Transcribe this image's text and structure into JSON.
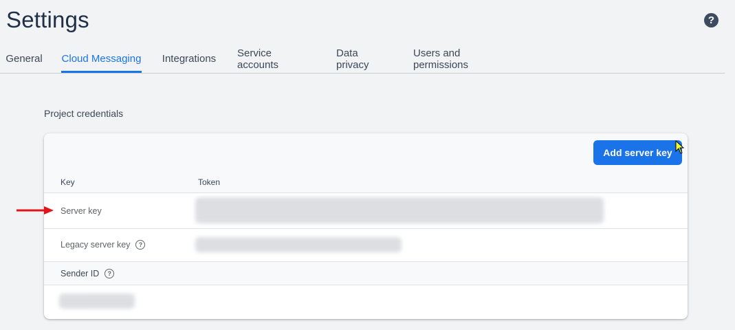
{
  "header": {
    "title": "Settings",
    "help_icon": "help-icon"
  },
  "tabs": [
    {
      "label": "General",
      "active": false
    },
    {
      "label": "Cloud Messaging",
      "active": true
    },
    {
      "label": "Integrations",
      "active": false
    },
    {
      "label": "Service accounts",
      "active": false
    },
    {
      "label": "Data privacy",
      "active": false
    },
    {
      "label": "Users and permissions",
      "active": false
    }
  ],
  "credentials": {
    "section_title": "Project credentials",
    "add_button_label": "Add server key",
    "columns": {
      "key": "Key",
      "token": "Token"
    },
    "rows": [
      {
        "label": "Server key",
        "help": false
      },
      {
        "label": "Legacy server key",
        "help": true
      }
    ],
    "sender": {
      "label": "Sender ID",
      "help": true
    }
  },
  "colors": {
    "accent": "#1a73e8",
    "annotation_arrow": "#e0141b"
  }
}
